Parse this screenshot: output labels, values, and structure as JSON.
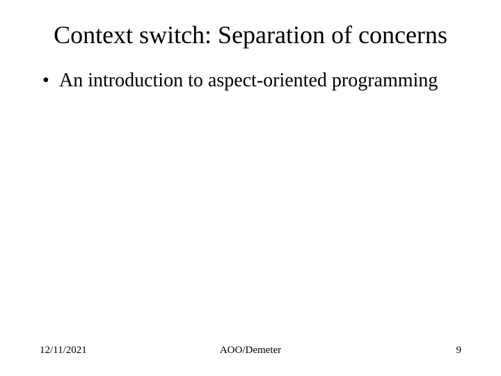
{
  "slide": {
    "title": "Context switch: Separation of concerns",
    "bullets": [
      "An introduction to aspect-oriented programming"
    ]
  },
  "footer": {
    "date": "12/11/2021",
    "center": "AOO/Demeter",
    "page": "9"
  }
}
